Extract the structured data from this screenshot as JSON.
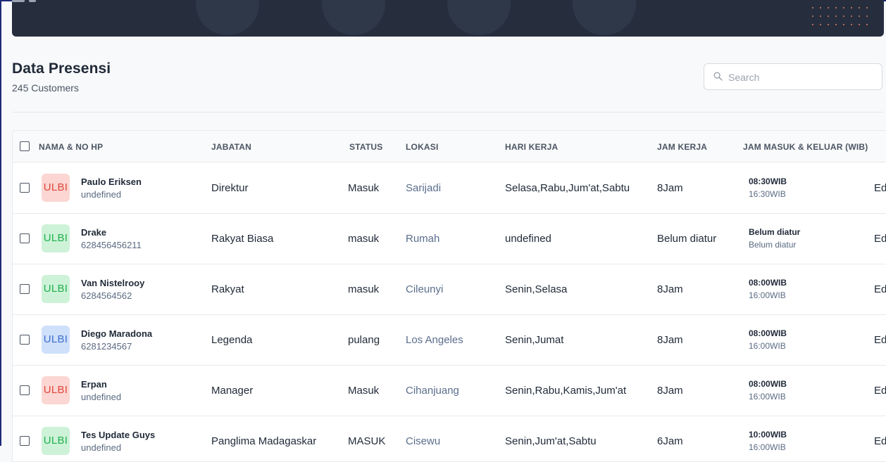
{
  "header": {
    "title": "Data Presensi",
    "subtitle": "245 Customers"
  },
  "search": {
    "placeholder": "Search",
    "value": ""
  },
  "table": {
    "columns": [
      "NAMA & NO HP",
      "JABATAN",
      "STATUS",
      "LOKASI",
      "HARI KERJA",
      "JAM KERJA",
      "JAM MASUK & KELUAR (WIB)"
    ],
    "action_label": "Ed",
    "rows": [
      {
        "avatar": "ULBI",
        "avatar_color": "red",
        "name": "Paulo Eriksen",
        "phone": "undefined",
        "jabatan": "Direktur",
        "status": "Masuk",
        "lokasi": "Sarijadi",
        "hari_kerja": "Selasa,Rabu,Jum'at,Sabtu",
        "jam_kerja": "8Jam",
        "jam_masuk": "08:30WIB",
        "jam_keluar": "16:30WIB"
      },
      {
        "avatar": "ULBI",
        "avatar_color": "green",
        "name": "Drake",
        "phone": "628456456211",
        "jabatan": "Rakyat Biasa",
        "status": "masuk",
        "lokasi": "Rumah",
        "hari_kerja": "undefined",
        "jam_kerja": "Belum diatur",
        "jam_masuk": "Belum diatur",
        "jam_keluar": "Belum diatur"
      },
      {
        "avatar": "ULBI",
        "avatar_color": "green",
        "name": "Van Nistelrooy",
        "phone": "6284564562",
        "jabatan": "Rakyat",
        "status": "masuk",
        "lokasi": "Cileunyi",
        "hari_kerja": "Senin,Selasa",
        "jam_kerja": "8Jam",
        "jam_masuk": "08:00WIB",
        "jam_keluar": "16:00WIB"
      },
      {
        "avatar": "ULBI",
        "avatar_color": "blue",
        "name": "Diego Maradona",
        "phone": "6281234567",
        "jabatan": "Legenda",
        "status": "pulang",
        "lokasi": "Los Angeles",
        "hari_kerja": "Senin,Jumat",
        "jam_kerja": "8Jam",
        "jam_masuk": "08:00WIB",
        "jam_keluar": "16:00WIB"
      },
      {
        "avatar": "ULBI",
        "avatar_color": "red",
        "name": "Erpan",
        "phone": "undefined",
        "jabatan": "Manager",
        "status": "Masuk",
        "lokasi": "Cihanjuang",
        "hari_kerja": "Senin,Rabu,Kamis,Jum'at",
        "jam_kerja": "8Jam",
        "jam_masuk": "08:00WIB",
        "jam_keluar": "16:00WIB"
      },
      {
        "avatar": "ULBI",
        "avatar_color": "green",
        "name": "Tes Update Guys",
        "phone": "undefined",
        "jabatan": "Panglima Madagaskar",
        "status": "MASUK",
        "lokasi": "Cisewu",
        "hari_kerja": "Senin,Jum'at,Sabtu",
        "jam_kerja": "6Jam",
        "jam_masuk": "10:00WIB",
        "jam_keluar": "16:00WIB"
      }
    ]
  },
  "colors": {
    "banner": "#262e3e",
    "avatar_red": "#e2463a",
    "avatar_green": "#22b14c",
    "avatar_blue": "#3d6fcf",
    "location_text": "#5a6e8c"
  }
}
